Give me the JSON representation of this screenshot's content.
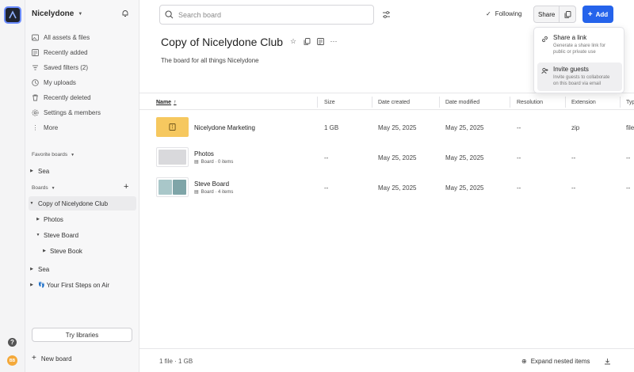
{
  "workspace": {
    "name": "Nicelydone"
  },
  "sidebar": {
    "nav": [
      {
        "label": "All assets & files",
        "icon": "assets-icon"
      },
      {
        "label": "Recently added",
        "icon": "recent-icon"
      },
      {
        "label": "Saved filters (2)",
        "icon": "filter-icon"
      },
      {
        "label": "My uploads",
        "icon": "upload-icon"
      },
      {
        "label": "Recently deleted",
        "icon": "trash-icon"
      },
      {
        "label": "Settings & members",
        "icon": "gear-icon"
      },
      {
        "label": "More",
        "icon": "more-icon"
      }
    ],
    "favorites_heading": "Favorite boards",
    "favorites": [
      {
        "label": "Sea"
      }
    ],
    "boards_heading": "Boards",
    "boards": {
      "copy": "Copy of Nicelydone Club",
      "photos": "Photos",
      "steve_board": "Steve Board",
      "steve_book": "Steve Book",
      "sea": "Sea",
      "first_steps": "Your First Steps on Air"
    },
    "try_libraries": "Try libraries",
    "new_board": "New board"
  },
  "rail": {
    "help": "?",
    "avatar": "BB"
  },
  "header": {
    "search_placeholder": "Search board",
    "following": "Following",
    "share": "Share",
    "add": "Add"
  },
  "board": {
    "title": "Copy of  Nicelydone Club",
    "description": "The board for all things Nicelydone"
  },
  "share_menu": {
    "items": [
      {
        "title": "Share a link",
        "subtitle_1": "Generate a share link for",
        "subtitle_2": "public or private use"
      },
      {
        "title": "Invite guests",
        "subtitle_1": "Invite guests to collaborate",
        "subtitle_2": "on this board via email"
      }
    ]
  },
  "table": {
    "columns": [
      "Name",
      "Size",
      "Date created",
      "Date modified",
      "Resolution",
      "Extension",
      "Typ"
    ],
    "sort_arrow": "↑",
    "rows": [
      {
        "name": "Nicelydone Marketing",
        "subtitle": "",
        "size": "1 GB",
        "created": "May 25, 2025",
        "modified": "May 25, 2025",
        "resolution": "--",
        "extension": "zip",
        "type": "file",
        "thumb_color": "#f6c85f"
      },
      {
        "name": "Photos",
        "subtitle": "Board · 0 items",
        "size": "--",
        "created": "May 25, 2025",
        "modified": "May 25, 2025",
        "resolution": "--",
        "extension": "--",
        "type": "--",
        "thumb_color": "#d9d9dc"
      },
      {
        "name": "Steve Board",
        "subtitle": "Board · 4 items",
        "size": "--",
        "created": "May 25, 2025",
        "modified": "May 25, 2025",
        "resolution": "--",
        "extension": "--",
        "type": "--",
        "thumb_color": "#9fbfc2"
      }
    ]
  },
  "footer": {
    "file_count": "1 file · 1 GB",
    "expand_nested": "Expand nested items"
  }
}
